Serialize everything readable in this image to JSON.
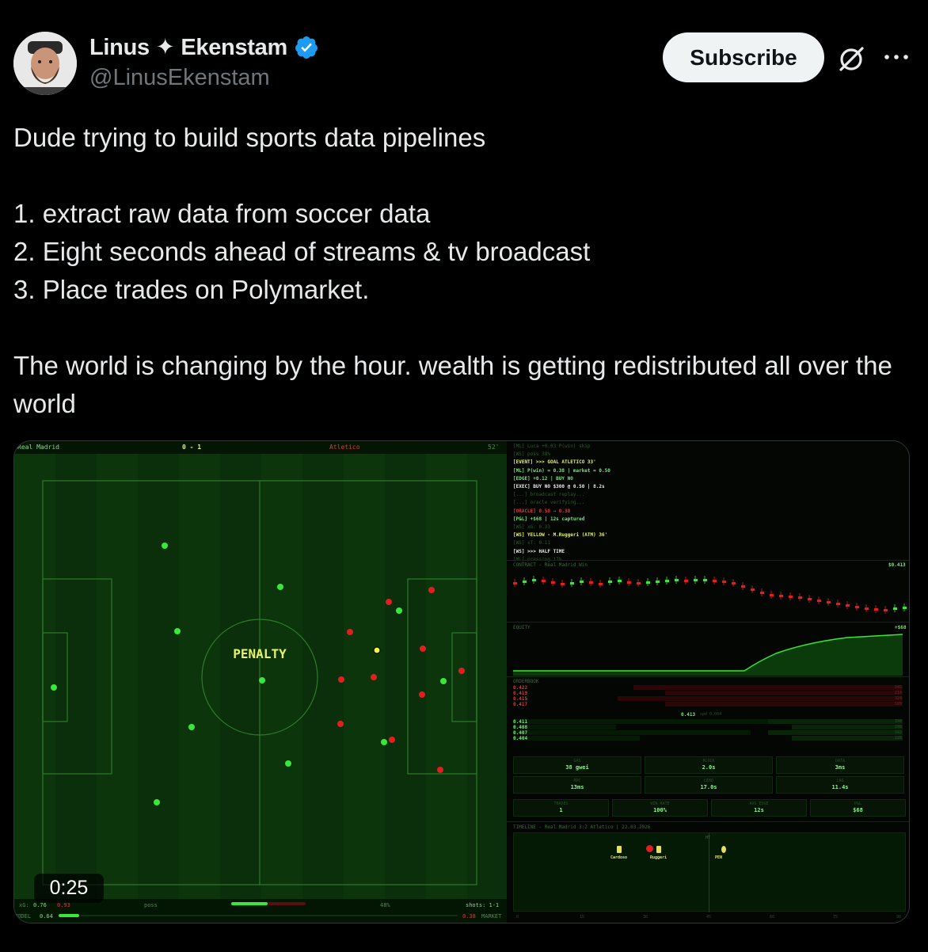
{
  "author": {
    "display_name": "Linus ✦ Ekenstam",
    "handle": "@LinusEkenstam",
    "verified": true
  },
  "actions": {
    "subscribe_label": "Subscribe"
  },
  "tweet": {
    "text": "Dude trying to build sports data pipelines\n\n1. extract raw data from soccer data\n2. Eight seconds ahead of streams & tv broadcast\n3. Place trades on Polymarket.\n\nThe world is changing by the hour. wealth is getting redistributed all over the world"
  },
  "video": {
    "time": "0:25"
  },
  "match": {
    "home": "Real Madrid",
    "score": "0 - 1",
    "away": "Atletico",
    "minute": "52'",
    "overlay": "PENALTY",
    "bottom": {
      "xg_label": "xG:",
      "xg_home": "0.76",
      "xg_away": "0.93",
      "poss_label": "poss",
      "poss_pct": "48%",
      "shots": "shots: 1-1",
      "model_label": "MODEL",
      "model_value": "0.64",
      "market_value": "0.38",
      "market_label": "MARKET"
    }
  },
  "log": [
    {
      "text": "[ML] Luca +0.03 P(win) skip",
      "color": "#2f5a2f"
    },
    {
      "text": "[WS] poss 38%",
      "color": "#2f5a2f"
    },
    {
      "text": "[EVENT] >>> GOAL ATLETICO 33'",
      "color": "#e6f26a"
    },
    {
      "text": "[ML] P(win) = 0.38 | market = 0.50",
      "color": "#7ce37c"
    },
    {
      "text": "[EDGE] +0.12 | BUY NO",
      "color": "#7ce37c"
    },
    {
      "text": "[EXEC] BUY NO $300 @ 0.50 | 8.2s",
      "color": "#e8e8e8"
    },
    {
      "text": "[...] broadcast replay...",
      "color": "#2f5a2f"
    },
    {
      "text": "[...] oracle verifying...",
      "color": "#2f5a2f"
    },
    {
      "text": "[ORACLE] 0.50 → 0.38",
      "color": "#d83a3a"
    },
    {
      "text": "[P&L] +$68 | 12s captured",
      "color": "#7ce37c"
    },
    {
      "text": "[WS] xG: 0.33",
      "color": "#2f5a2f"
    },
    {
      "text": "[WS] YELLOW - M.Ruggeri (ATM) 36'",
      "color": "#e6f26a"
    },
    {
      "text": "[WS] xT: 0.11",
      "color": "#2f5a2f"
    },
    {
      "text": "[WS] >>> HALF TIME",
      "color": "#e8e8e8"
    },
    {
      "text": "[ML] pressing 17%",
      "color": "#2f5a2f"
    }
  ],
  "contract": {
    "label": "CONTRACT - Real Madrid Win",
    "price": "$0.413"
  },
  "equity": {
    "label": "EQUITY",
    "value": "+$68"
  },
  "orderbook": {
    "label": "ORDERBOOK",
    "asks": [
      "0.422",
      "0.419",
      "0.415",
      "0.417"
    ],
    "ask_sizes": [
      "245",
      "218",
      "324",
      "589"
    ],
    "mid": "0.413",
    "spread_label": "spd 0.004",
    "bids": [
      "0.411",
      "0.408",
      "0.407",
      "0.404"
    ],
    "bid_sizes": [
      "398",
      "298",
      "562",
      "228"
    ]
  },
  "stats": {
    "row1": [
      {
        "label": "GAS",
        "value": "38 gwei"
      },
      {
        "label": "BLOCK",
        "value": "2.0s"
      },
      {
        "label": "DATA",
        "value": "3ms"
      }
    ],
    "row2": [
      {
        "label": "RPC",
        "value": "13ms"
      },
      {
        "label": "LEAD",
        "value": "17.0s"
      },
      {
        "label": "LAG",
        "value": "11.4s"
      }
    ],
    "row3": [
      {
        "label": "TRADES",
        "value": "1"
      },
      {
        "label": "WIN RATE",
        "value": "100%"
      },
      {
        "label": "AVG EDGE",
        "value": "12s"
      },
      {
        "label": "P&L",
        "value": "$68"
      }
    ]
  },
  "timeline": {
    "label": "TIMELINE - Real Madrid 3:2 Atletico | 22.03.2026",
    "ht": "HT",
    "events": [
      {
        "name": "Cardoso",
        "color": "#e6e05a"
      },
      {
        "name": "Ruggeri",
        "color": "#e6e05a"
      },
      {
        "name": "PEN",
        "color": "#e6e05a"
      }
    ],
    "ticks": [
      "0",
      "15",
      "30",
      "45",
      "60",
      "75",
      "90"
    ]
  },
  "colors": {
    "accent_green": "#39e639",
    "accent_red": "#e02020",
    "verified_blue": "#1d9bf0",
    "penalty_yellow": "#e6f26a"
  }
}
